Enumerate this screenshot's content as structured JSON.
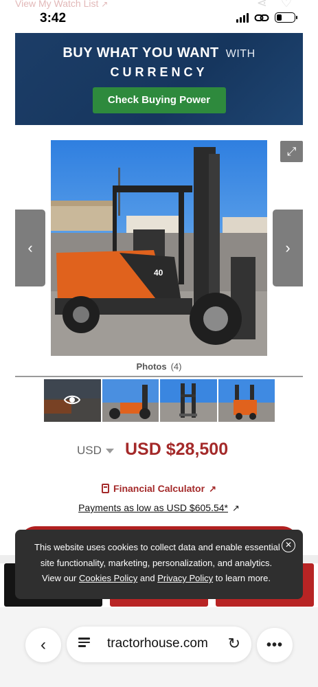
{
  "top": {
    "ghost_link": "View My Watch List",
    "time": "3:42",
    "battery_level": 0.3
  },
  "banner": {
    "headline": "BUY WHAT YOU WANT",
    "with": "WITH",
    "brand": "CURRENCY",
    "button": "Check Buying Power"
  },
  "gallery": {
    "photos_label": "Photos",
    "photos_count": "(4)",
    "prev_icon": "chevron-left-icon",
    "next_icon": "chevron-right-icon",
    "expand_icon": "expand-icon"
  },
  "price": {
    "currency": "USD",
    "amount": "USD $28,500"
  },
  "finance": {
    "calculator_label": "Financial Calculator",
    "payments_label": "Payments as low as USD $605.54*"
  },
  "cookie": {
    "line1": "This website uses cookies to collect data and enable essential",
    "line2": "site functionality, marketing, personalization, and analytics.",
    "line3_pre": "View our",
    "cookies_policy": "Cookies Policy",
    "and": "and",
    "privacy_policy": "Privacy Policy",
    "line3_post": "to learn more."
  },
  "browser": {
    "url": "tractorhouse.com"
  },
  "colors": {
    "accent_red": "#a42a2a",
    "banner_blue": "#1c3d67",
    "button_green": "#2e8a3d"
  }
}
